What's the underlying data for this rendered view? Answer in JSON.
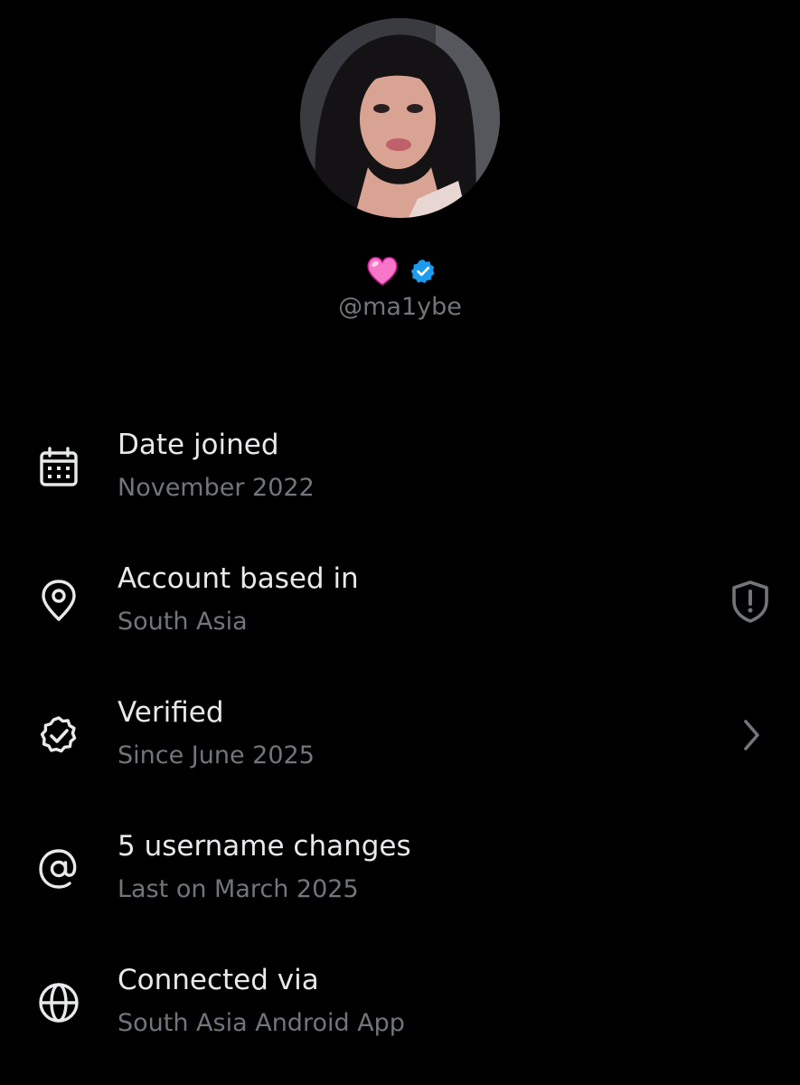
{
  "profile": {
    "handle": "@ma1ybe",
    "name_emoji": "heart-emoji",
    "verified_badge_color": "#1d9bf0"
  },
  "about": [
    {
      "icon": "calendar-icon",
      "title": "Date joined",
      "subtitle": "November 2022",
      "action": null
    },
    {
      "icon": "location-pin-icon",
      "title": "Account based in",
      "subtitle": "South Asia",
      "action": "shield-alert-icon"
    },
    {
      "icon": "verified-check-icon",
      "title": "Verified",
      "subtitle": "Since June 2025",
      "action": "chevron-right-icon"
    },
    {
      "icon": "at-sign-icon",
      "title": "5 username changes",
      "subtitle": "Last on March 2025",
      "action": null
    },
    {
      "icon": "globe-icon",
      "title": "Connected via",
      "subtitle": "South Asia Android App",
      "action": null
    }
  ],
  "colors": {
    "background": "#000000",
    "primary_text": "#e7e9ea",
    "secondary_text": "#71767b",
    "accent": "#1d9bf0"
  }
}
